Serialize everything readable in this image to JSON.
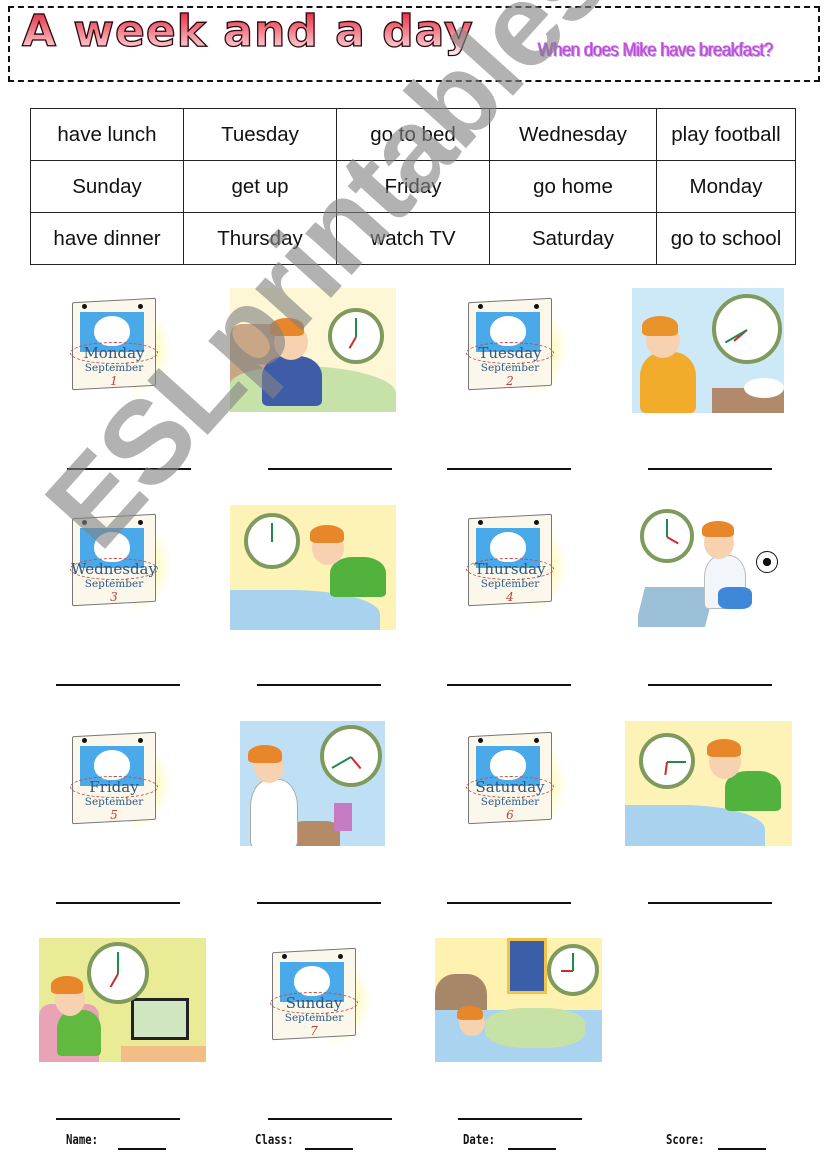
{
  "header": {
    "title": "A week and a day",
    "subtitle": "When does Mike have breakfast?"
  },
  "word_bank": {
    "rows": [
      [
        "have lunch",
        "Tuesday",
        "go to bed",
        "Wednesday",
        "play football"
      ],
      [
        "Sunday",
        "get up",
        "Friday",
        "go home",
        "Monday"
      ],
      [
        "have dinner",
        "Thursday",
        "watch TV",
        "Saturday",
        "go to school"
      ]
    ]
  },
  "calendar_month": "September",
  "exercises": [
    {
      "type": "calendar",
      "day": "Monday",
      "date": "1",
      "answer": ""
    },
    {
      "type": "scene",
      "activity_icon": "get-up-scene",
      "clock_time": "7:00",
      "answer": ""
    },
    {
      "type": "calendar",
      "day": "Tuesday",
      "date": "2",
      "answer": ""
    },
    {
      "type": "scene",
      "activity_icon": "go-to-school-scene",
      "clock_time": "7:40",
      "answer": ""
    },
    {
      "type": "calendar",
      "day": "Wednesday",
      "date": "3",
      "answer": ""
    },
    {
      "type": "scene",
      "activity_icon": "have-lunch-scene",
      "clock_time": "12:00",
      "answer": ""
    },
    {
      "type": "calendar",
      "day": "Thursday",
      "date": "4",
      "answer": ""
    },
    {
      "type": "scene",
      "activity_icon": "play-football-scene",
      "clock_time": "4:00",
      "answer": ""
    },
    {
      "type": "calendar",
      "day": "Friday",
      "date": "5",
      "answer": ""
    },
    {
      "type": "scene",
      "activity_icon": "go-home-scene",
      "clock_time": "4:40",
      "answer": ""
    },
    {
      "type": "calendar",
      "day": "Saturday",
      "date": "6",
      "answer": ""
    },
    {
      "type": "scene",
      "activity_icon": "have-dinner-scene",
      "clock_time": "6:15",
      "answer": ""
    },
    {
      "type": "scene",
      "activity_icon": "watch-tv-scene",
      "clock_time": "7:00",
      "answer": ""
    },
    {
      "type": "calendar",
      "day": "Sunday",
      "date": "7",
      "answer": ""
    },
    {
      "type": "scene",
      "activity_icon": "go-to-bed-scene",
      "clock_time": "9:00",
      "answer": ""
    }
  ],
  "footer": {
    "name_label": "Name:",
    "class_label": "Class:",
    "date_label": "Date:",
    "score_label": "Score:"
  },
  "watermark": "ESLprintables.com",
  "colors": {
    "title_red": "#e2283c",
    "subtitle_purple": "#c04ad8",
    "clock_rim": "#7e9a5c",
    "calendar_blue": "#4aa9e8"
  }
}
